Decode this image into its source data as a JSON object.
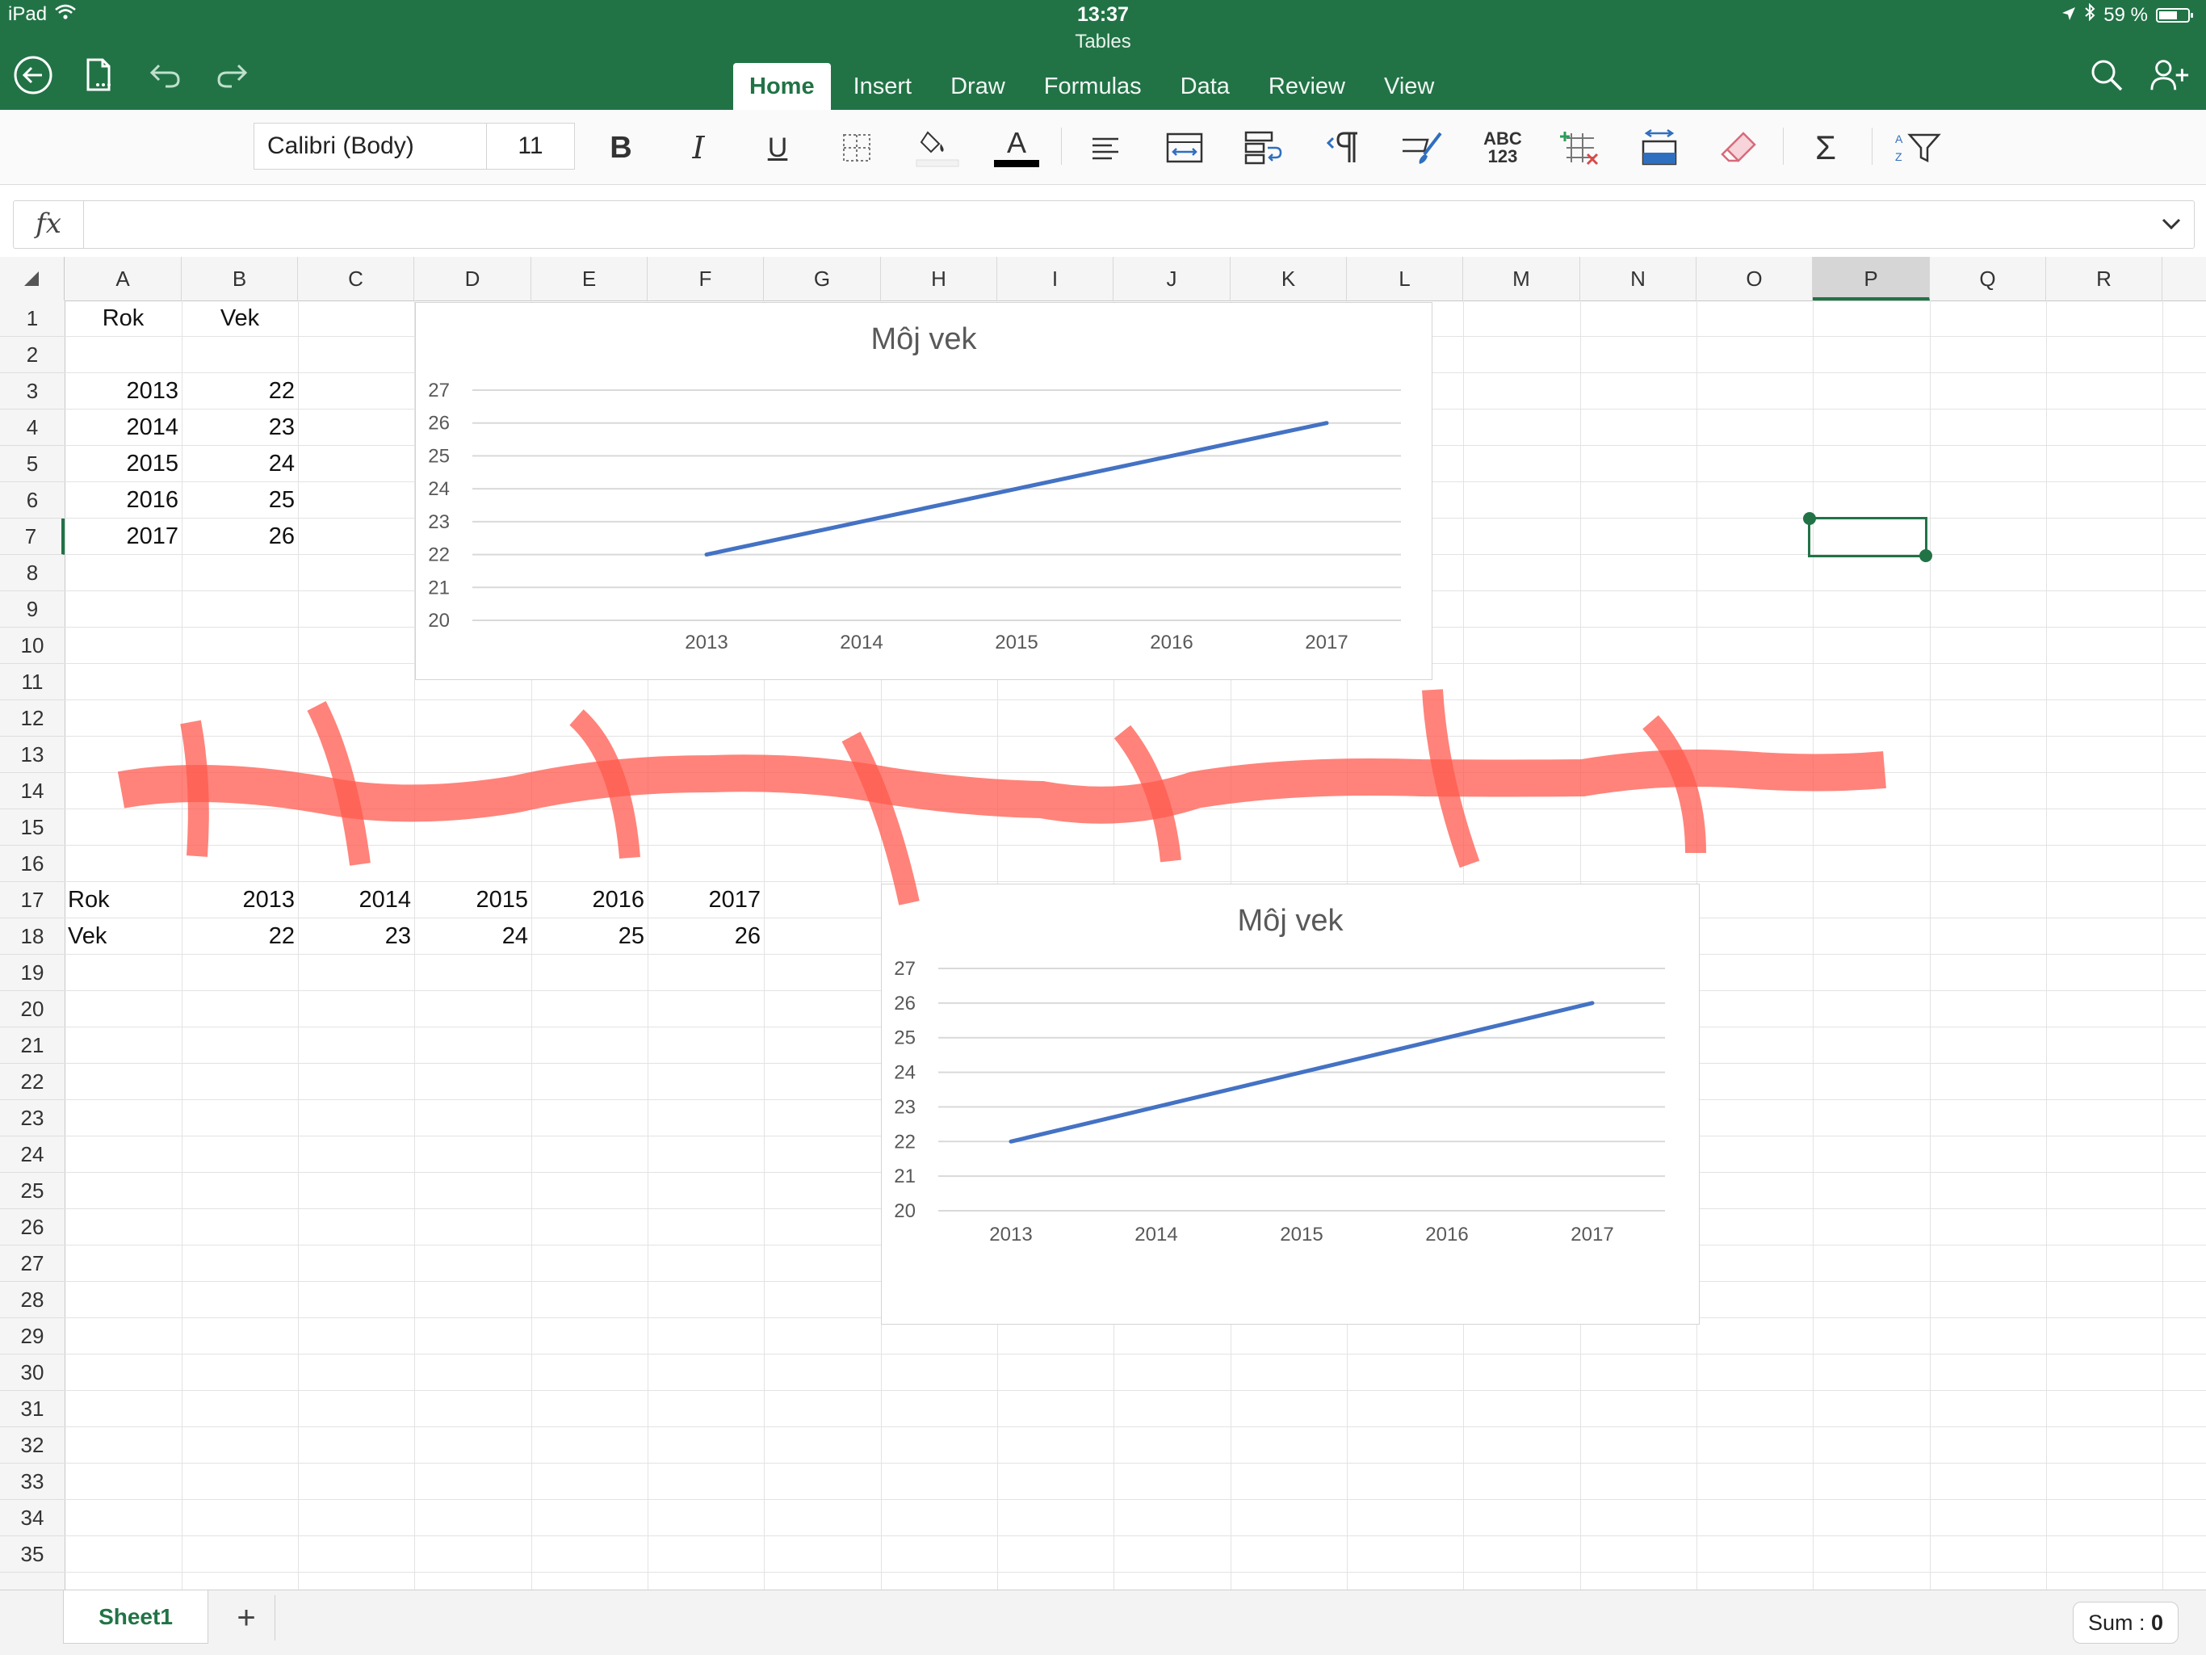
{
  "status_bar": {
    "device": "iPad",
    "time": "13:37",
    "battery": "59 %"
  },
  "app": {
    "document_title": "Tables"
  },
  "tabs": [
    {
      "label": "Home",
      "active": true
    },
    {
      "label": "Insert",
      "active": false
    },
    {
      "label": "Draw",
      "active": false
    },
    {
      "label": "Formulas",
      "active": false
    },
    {
      "label": "Data",
      "active": false
    },
    {
      "label": "Review",
      "active": false
    },
    {
      "label": "View",
      "active": false
    }
  ],
  "ribbon": {
    "font_name": "Calibri (Body)",
    "font_size": "11",
    "bold_label": "B",
    "italic_label": "I",
    "underline_label": "U",
    "font_color_label": "A",
    "number_format_label_top": "ABC",
    "number_format_label_bottom": "123",
    "autosum_label": "Σ"
  },
  "formula_bar": {
    "fx_label": "fx",
    "value": ""
  },
  "columns": [
    "A",
    "B",
    "C",
    "D",
    "E",
    "F",
    "G",
    "H",
    "I",
    "J",
    "K",
    "L",
    "M",
    "N",
    "O",
    "P",
    "Q",
    "R"
  ],
  "selected_column": "P",
  "selected_row": "7",
  "rows": [
    "1",
    "2",
    "3",
    "4",
    "5",
    "6",
    "7",
    "8",
    "9",
    "10",
    "11",
    "12",
    "13",
    "14",
    "15",
    "16",
    "17",
    "18",
    "19",
    "20",
    "21",
    "22",
    "23",
    "24",
    "25",
    "26",
    "27",
    "28",
    "29",
    "30",
    "31",
    "32",
    "33",
    "34",
    "35"
  ],
  "cells": {
    "a1": "Rok",
    "b1": "Vek",
    "a3": "2013",
    "b3": "22",
    "a4": "2014",
    "b4": "23",
    "a5": "2015",
    "b5": "24",
    "a6": "2016",
    "b6": "25",
    "a7": "2017",
    "b7": "26",
    "a17": "Rok",
    "b17": "2013",
    "c17": "2014",
    "d17": "2015",
    "e17": "2016",
    "f17": "2017",
    "a18": "Vek",
    "b18": "22",
    "c18": "23",
    "d18": "24",
    "e18": "25",
    "f18": "26"
  },
  "chart_data": [
    {
      "type": "line",
      "title": "Môj vek",
      "categories": [
        "2013",
        "2014",
        "2015",
        "2016",
        "2017"
      ],
      "series": [
        {
          "values": [
            22,
            23,
            24,
            25,
            26
          ],
          "color": "#4472c4"
        }
      ],
      "yticks": [
        "20",
        "21",
        "22",
        "23",
        "24",
        "25",
        "26",
        "27"
      ],
      "ylim": [
        20,
        27
      ],
      "grid": true
    },
    {
      "type": "line",
      "title": "Môj vek",
      "categories": [
        "2013",
        "2014",
        "2015",
        "2016",
        "2017"
      ],
      "series": [
        {
          "values": [
            22,
            23,
            24,
            25,
            26
          ],
          "color": "#4472c4"
        }
      ],
      "yticks": [
        "20",
        "21",
        "22",
        "23",
        "24",
        "25",
        "26",
        "27"
      ],
      "ylim": [
        20,
        27
      ],
      "grid": true
    }
  ],
  "bottom_bar": {
    "sheet_tab": "Sheet1",
    "add_sheet": "+",
    "sum_label": "Sum : ",
    "sum_value": "0"
  },
  "colors": {
    "accent": "#217346",
    "series": "#4472c4",
    "ink_mark": "#ff5a4e"
  }
}
